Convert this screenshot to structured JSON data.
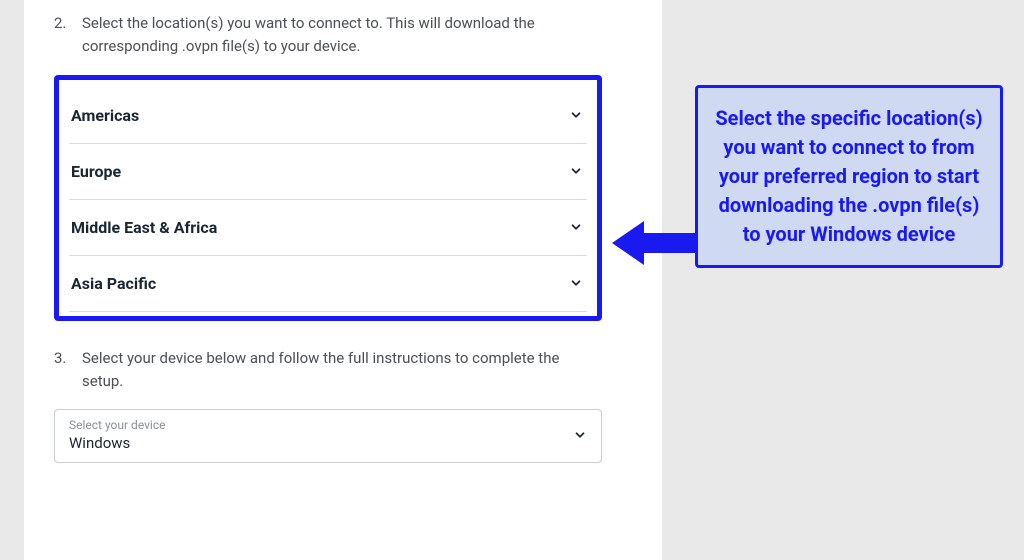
{
  "steps": {
    "s2": {
      "num": "2.",
      "text": "Select the location(s) you want to connect to. This will download the corresponding .ovpn file(s) to your device."
    },
    "s3": {
      "num": "3.",
      "text": "Select your device below and follow the full instructions to complete the setup."
    }
  },
  "regions": {
    "r0": "Americas",
    "r1": "Europe",
    "r2": "Middle East & Africa",
    "r3": "Asia Pacific"
  },
  "device": {
    "label": "Select your device",
    "value": "Windows"
  },
  "callout": {
    "text": "Select the specific location(s) you want to connect to from your preferred region to start downloading the .ovpn file(s) to your Windows device"
  }
}
